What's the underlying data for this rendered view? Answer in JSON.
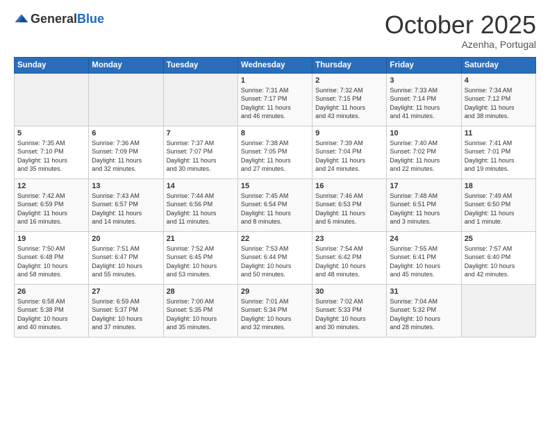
{
  "logo": {
    "general": "General",
    "blue": "Blue"
  },
  "header": {
    "title": "October 2025",
    "location": "Azenha, Portugal"
  },
  "weekdays": [
    "Sunday",
    "Monday",
    "Tuesday",
    "Wednesday",
    "Thursday",
    "Friday",
    "Saturday"
  ],
  "weeks": [
    [
      {
        "day": "",
        "info": ""
      },
      {
        "day": "",
        "info": ""
      },
      {
        "day": "",
        "info": ""
      },
      {
        "day": "1",
        "info": "Sunrise: 7:31 AM\nSunset: 7:17 PM\nDaylight: 11 hours\nand 46 minutes."
      },
      {
        "day": "2",
        "info": "Sunrise: 7:32 AM\nSunset: 7:15 PM\nDaylight: 11 hours\nand 43 minutes."
      },
      {
        "day": "3",
        "info": "Sunrise: 7:33 AM\nSunset: 7:14 PM\nDaylight: 11 hours\nand 41 minutes."
      },
      {
        "day": "4",
        "info": "Sunrise: 7:34 AM\nSunset: 7:12 PM\nDaylight: 11 hours\nand 38 minutes."
      }
    ],
    [
      {
        "day": "5",
        "info": "Sunrise: 7:35 AM\nSunset: 7:10 PM\nDaylight: 11 hours\nand 35 minutes."
      },
      {
        "day": "6",
        "info": "Sunrise: 7:36 AM\nSunset: 7:09 PM\nDaylight: 11 hours\nand 32 minutes."
      },
      {
        "day": "7",
        "info": "Sunrise: 7:37 AM\nSunset: 7:07 PM\nDaylight: 11 hours\nand 30 minutes."
      },
      {
        "day": "8",
        "info": "Sunrise: 7:38 AM\nSunset: 7:05 PM\nDaylight: 11 hours\nand 27 minutes."
      },
      {
        "day": "9",
        "info": "Sunrise: 7:39 AM\nSunset: 7:04 PM\nDaylight: 11 hours\nand 24 minutes."
      },
      {
        "day": "10",
        "info": "Sunrise: 7:40 AM\nSunset: 7:02 PM\nDaylight: 11 hours\nand 22 minutes."
      },
      {
        "day": "11",
        "info": "Sunrise: 7:41 AM\nSunset: 7:01 PM\nDaylight: 11 hours\nand 19 minutes."
      }
    ],
    [
      {
        "day": "12",
        "info": "Sunrise: 7:42 AM\nSunset: 6:59 PM\nDaylight: 11 hours\nand 16 minutes."
      },
      {
        "day": "13",
        "info": "Sunrise: 7:43 AM\nSunset: 6:57 PM\nDaylight: 11 hours\nand 14 minutes."
      },
      {
        "day": "14",
        "info": "Sunrise: 7:44 AM\nSunset: 6:56 PM\nDaylight: 11 hours\nand 11 minutes."
      },
      {
        "day": "15",
        "info": "Sunrise: 7:45 AM\nSunset: 6:54 PM\nDaylight: 11 hours\nand 8 minutes."
      },
      {
        "day": "16",
        "info": "Sunrise: 7:46 AM\nSunset: 6:53 PM\nDaylight: 11 hours\nand 6 minutes."
      },
      {
        "day": "17",
        "info": "Sunrise: 7:48 AM\nSunset: 6:51 PM\nDaylight: 11 hours\nand 3 minutes."
      },
      {
        "day": "18",
        "info": "Sunrise: 7:49 AM\nSunset: 6:50 PM\nDaylight: 11 hours\nand 1 minute."
      }
    ],
    [
      {
        "day": "19",
        "info": "Sunrise: 7:50 AM\nSunset: 6:48 PM\nDaylight: 10 hours\nand 58 minutes."
      },
      {
        "day": "20",
        "info": "Sunrise: 7:51 AM\nSunset: 6:47 PM\nDaylight: 10 hours\nand 55 minutes."
      },
      {
        "day": "21",
        "info": "Sunrise: 7:52 AM\nSunset: 6:45 PM\nDaylight: 10 hours\nand 53 minutes."
      },
      {
        "day": "22",
        "info": "Sunrise: 7:53 AM\nSunset: 6:44 PM\nDaylight: 10 hours\nand 50 minutes."
      },
      {
        "day": "23",
        "info": "Sunrise: 7:54 AM\nSunset: 6:42 PM\nDaylight: 10 hours\nand 48 minutes."
      },
      {
        "day": "24",
        "info": "Sunrise: 7:55 AM\nSunset: 6:41 PM\nDaylight: 10 hours\nand 45 minutes."
      },
      {
        "day": "25",
        "info": "Sunrise: 7:57 AM\nSunset: 6:40 PM\nDaylight: 10 hours\nand 42 minutes."
      }
    ],
    [
      {
        "day": "26",
        "info": "Sunrise: 6:58 AM\nSunset: 5:38 PM\nDaylight: 10 hours\nand 40 minutes."
      },
      {
        "day": "27",
        "info": "Sunrise: 6:59 AM\nSunset: 5:37 PM\nDaylight: 10 hours\nand 37 minutes."
      },
      {
        "day": "28",
        "info": "Sunrise: 7:00 AM\nSunset: 5:35 PM\nDaylight: 10 hours\nand 35 minutes."
      },
      {
        "day": "29",
        "info": "Sunrise: 7:01 AM\nSunset: 5:34 PM\nDaylight: 10 hours\nand 32 minutes."
      },
      {
        "day": "30",
        "info": "Sunrise: 7:02 AM\nSunset: 5:33 PM\nDaylight: 10 hours\nand 30 minutes."
      },
      {
        "day": "31",
        "info": "Sunrise: 7:04 AM\nSunset: 5:32 PM\nDaylight: 10 hours\nand 28 minutes."
      },
      {
        "day": "",
        "info": ""
      }
    ]
  ]
}
